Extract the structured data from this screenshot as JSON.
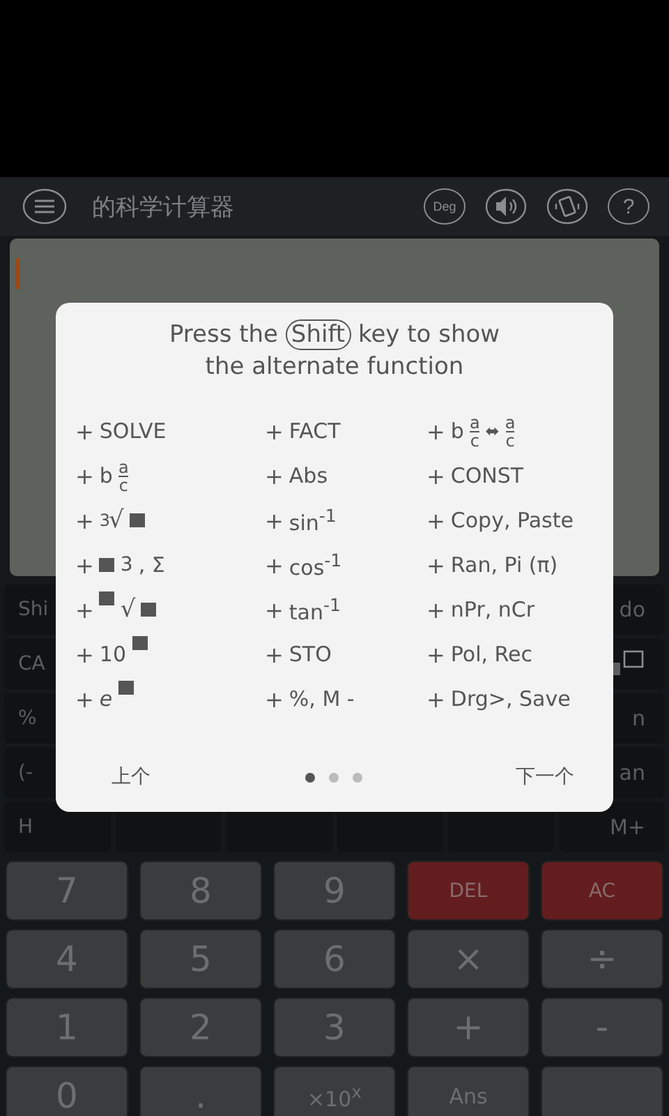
{
  "app_bar": {
    "title": "的科学计算器",
    "angle_mode": "Deg",
    "help": "?"
  },
  "shift_keys": {
    "left": [
      "Shi",
      "CA",
      "%",
      "(-",
      "H"
    ],
    "right": [
      {
        "kind": "text",
        "text": "do"
      },
      {
        "kind": "icon"
      },
      {
        "kind": "text",
        "text": "n"
      },
      {
        "kind": "text",
        "text": "an"
      },
      {
        "kind": "text",
        "text": "M+"
      }
    ]
  },
  "keypad": [
    {
      "label": "7",
      "kind": "digit"
    },
    {
      "label": "8",
      "kind": "digit"
    },
    {
      "label": "9",
      "kind": "digit"
    },
    {
      "label": "DEL",
      "kind": "clear"
    },
    {
      "label": "AC",
      "kind": "clear"
    },
    {
      "label": "4",
      "kind": "digit"
    },
    {
      "label": "5",
      "kind": "digit"
    },
    {
      "label": "6",
      "kind": "digit"
    },
    {
      "label": "×",
      "kind": "operator"
    },
    {
      "label": "÷",
      "kind": "operator"
    },
    {
      "label": "1",
      "kind": "digit"
    },
    {
      "label": "2",
      "kind": "digit"
    },
    {
      "label": "3",
      "kind": "digit"
    },
    {
      "label": "+",
      "kind": "operator"
    },
    {
      "label": "-",
      "kind": "operator"
    },
    {
      "label": "0",
      "kind": "digit"
    },
    {
      "label": ".",
      "kind": "digit"
    },
    {
      "label": "×10$^{x}$",
      "kind": "small"
    },
    {
      "label": "Ans",
      "kind": "small"
    },
    {
      "kind": "blank"
    }
  ],
  "dialog": {
    "title_before": "Press the",
    "key": "Shift",
    "title_after": "key to show",
    "title_line2": "the alternate function",
    "items": [
      {
        "kind": "text",
        "sign": "+",
        "text": "SOLVE"
      },
      {
        "kind": "text",
        "sign": "+",
        "text": "FACT"
      },
      {
        "kind": "fraction_swap",
        "sign": "+",
        "whole": "b",
        "num": "a",
        "den": "c",
        "swap": "⬌",
        "num2": "a",
        "den2": "c"
      },
      {
        "kind": "fraction",
        "sign": "+",
        "whole": "b",
        "num": "a",
        "den": "c"
      },
      {
        "kind": "text",
        "sign": "+",
        "text": "Abs"
      },
      {
        "kind": "text",
        "sign": "+",
        "text": "CONST"
      },
      {
        "kind": "root",
        "sign": "+",
        "index": "3",
        "radical": "√"
      },
      {
        "kind": "text",
        "sign": "+",
        "text": "sin$^{-1}$"
      },
      {
        "kind": "text",
        "sign": "+",
        "text": "Copy, Paste"
      },
      {
        "kind": "box_power",
        "sign": "+",
        "exponent": "3",
        "suffix": ", Σ"
      },
      {
        "kind": "text",
        "sign": "+",
        "text": "cos$^{-1}$"
      },
      {
        "kind": "text",
        "sign": "+",
        "text": "Ran, Pi (π)"
      },
      {
        "kind": "box_root",
        "sign": "+",
        "radical": "√"
      },
      {
        "kind": "text",
        "sign": "+",
        "text": "tan$^{-1}$"
      },
      {
        "kind": "text",
        "sign": "+",
        "text": "nPr, nCr"
      },
      {
        "kind": "power",
        "sign": "+",
        "base": "10",
        "italic": false
      },
      {
        "kind": "text",
        "sign": "+",
        "text": "STO"
      },
      {
        "kind": "text",
        "sign": "+",
        "text": "Pol, Rec"
      },
      {
        "kind": "power",
        "sign": "+",
        "base": "e",
        "italic": true
      },
      {
        "kind": "text",
        "sign": "+",
        "text": "%, M -"
      },
      {
        "kind": "text",
        "sign": "+",
        "text": "Drg>, Save"
      }
    ],
    "prev": "上个",
    "next": "下一个",
    "pages": [
      {
        "selected": true
      },
      {
        "selected": false
      },
      {
        "selected": false
      }
    ]
  }
}
